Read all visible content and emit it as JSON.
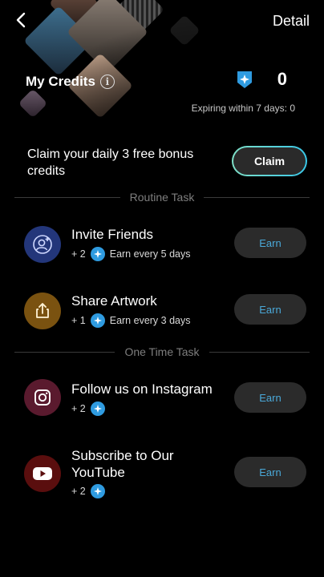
{
  "header": {
    "detail_label": "Detail",
    "credits_title": "My Credits",
    "info_glyph": "i",
    "credits_value": "0",
    "expiring": "Expiring within 7 days: 0"
  },
  "claim": {
    "text": "Claim your daily 3 free bonus credits",
    "button_label": "Claim"
  },
  "sections": {
    "routine": "Routine Task",
    "one_time": "One Time Task"
  },
  "tasks": [
    {
      "title": "Invite Friends",
      "reward": "+ 2",
      "detail": "Earn every 5 days",
      "button": "Earn",
      "icon": "add-user-icon"
    },
    {
      "title": "Share Artwork",
      "reward": "+ 1",
      "detail": "Earn every 3 days",
      "button": "Earn",
      "icon": "share-icon"
    },
    {
      "title": "Follow us on Instagram",
      "reward": "+ 2",
      "detail": "",
      "button": "Earn",
      "icon": "instagram-icon"
    },
    {
      "title": "Subscribe to Our YouTube",
      "reward": "+ 2",
      "detail": "",
      "button": "Earn",
      "icon": "youtube-icon"
    }
  ],
  "colors": {
    "background": "#000000",
    "earn_text": "#4aa8d8",
    "gem_blue": "#2f9be0",
    "claim_border_start": "#7fe0c8",
    "claim_border_end": "#39c7e8",
    "invite_icon_bg": "#23367a",
    "share_icon_bg": "#7a5210",
    "instagram_icon_bg": "#5a1a2e",
    "youtube_icon_bg": "#5a0e0e"
  }
}
